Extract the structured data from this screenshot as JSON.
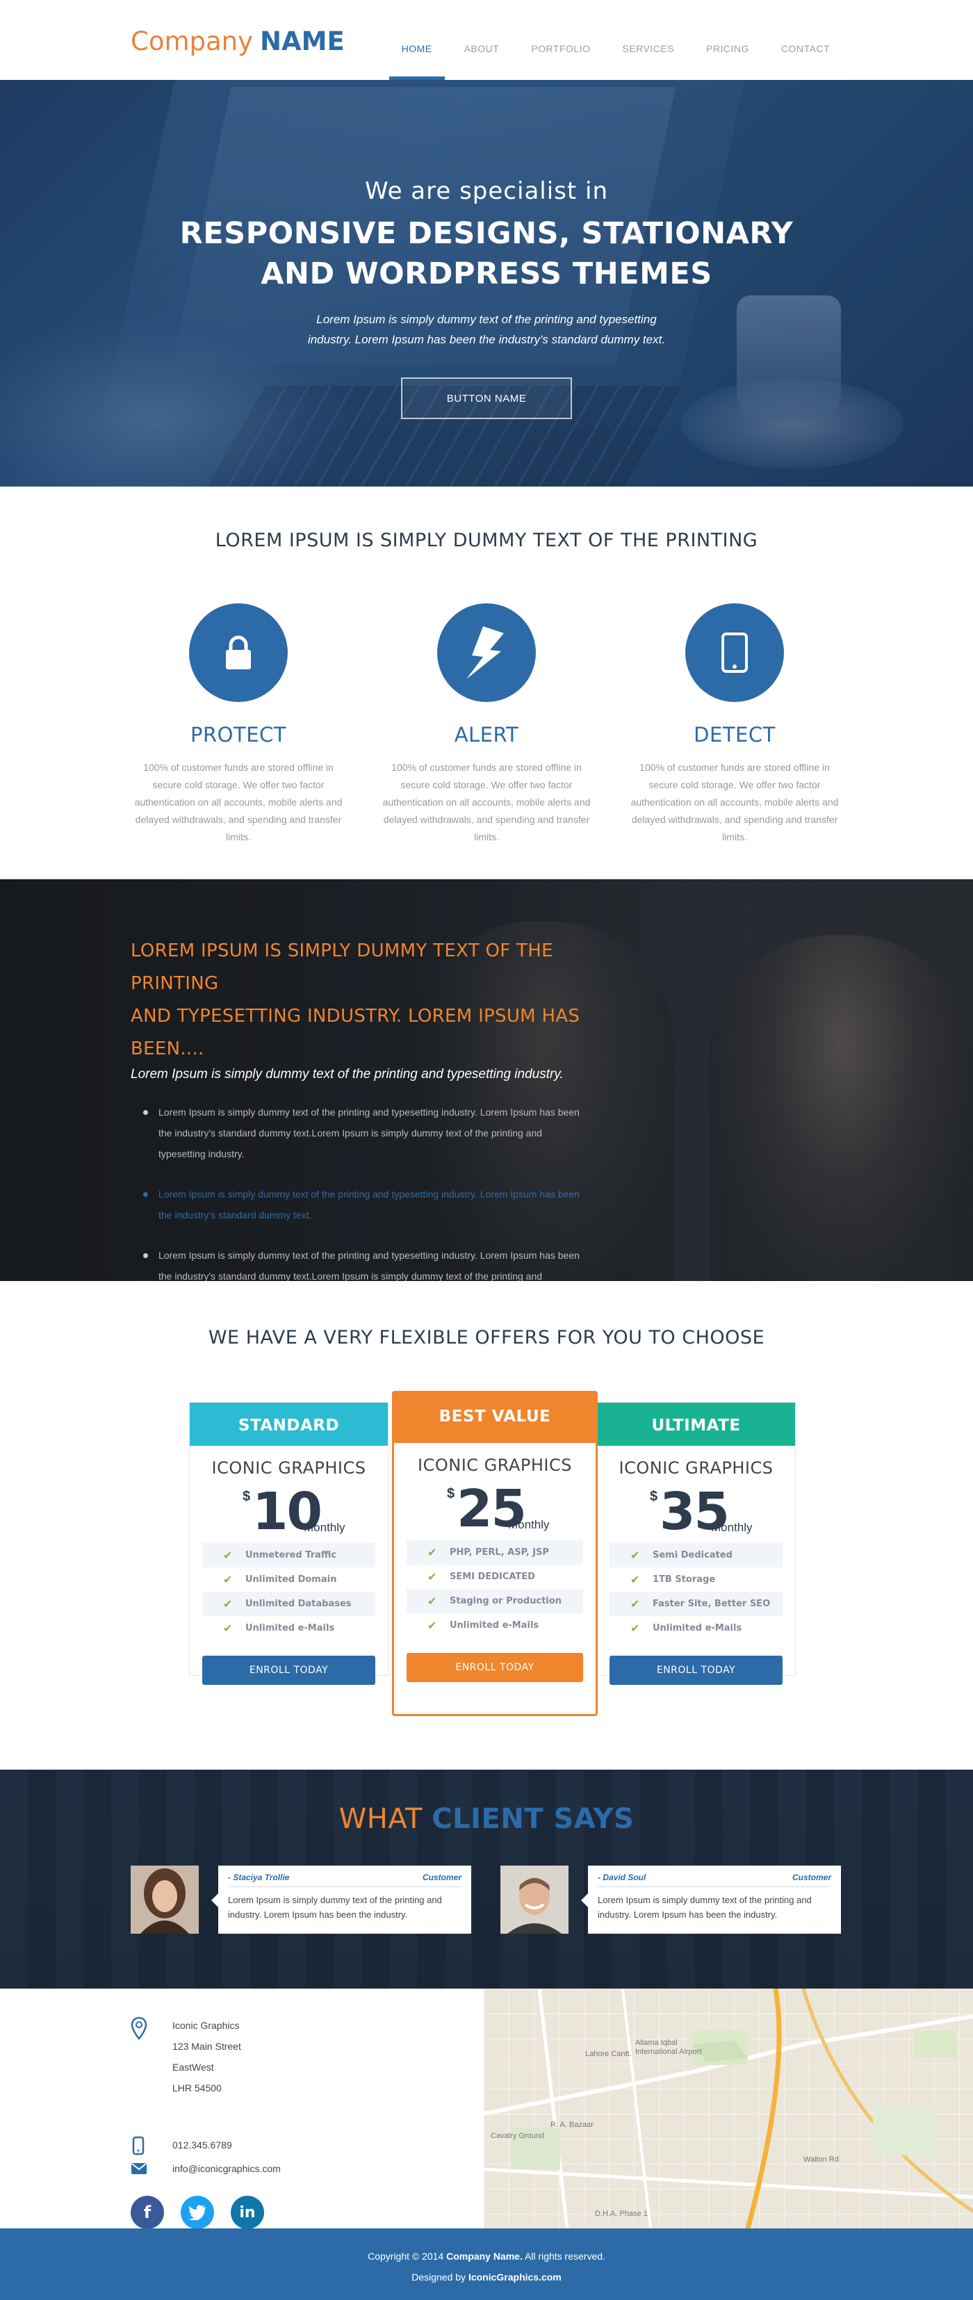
{
  "header": {
    "logo_company": "Company",
    "logo_name": "NAME",
    "nav": [
      "HOME",
      "ABOUT",
      "PORTFOLIO",
      "SERVICES",
      "PRICING",
      "CONTACT"
    ],
    "active_nav": "HOME"
  },
  "hero": {
    "pretitle": "We are specialist in",
    "title_line1": "RESPONSIVE DESIGNS, STATIONARY",
    "title_line2": "AND WORDPRESS THEMES",
    "subtitle_line1": "Lorem Ipsum is simply dummy text of the printing and typesetting",
    "subtitle_line2": "industry. Lorem Ipsum has been the industry's standard dummy text.",
    "button_label": "BUTTON NAME"
  },
  "features": {
    "heading": "LOREM IPSUM IS SIMPLY DUMMY TEXT OF THE PRINTING",
    "items": [
      {
        "title": "PROTECT",
        "icon": "lock-icon",
        "text": "100% of customer funds are stored offline in secure cold storage. We offer two factor authentication on all accounts, mobile alerts and delayed withdrawals, and spending and transfer limits."
      },
      {
        "title": "ALERT",
        "icon": "lightning-icon",
        "text": "100% of customer funds are stored offline in secure cold storage. We offer two factor authentication on all accounts, mobile alerts and delayed withdrawals, and spending and transfer limits."
      },
      {
        "title": "DETECT",
        "icon": "mobile-icon",
        "text": "100% of customer funds are stored offline in secure cold storage. We offer two factor authentication on all accounts, mobile alerts and delayed withdrawals, and spending and transfer limits."
      }
    ]
  },
  "about": {
    "heading_line1": "LOREM IPSUM IS SIMPLY DUMMY TEXT OF THE PRINTING",
    "heading_line2": "AND TYPESETTING INDUSTRY. LOREM IPSUM HAS BEEN....",
    "lead": "Lorem Ipsum is simply dummy text of the printing and typesetting industry.",
    "bullets": [
      "Lorem Ipsum is simply dummy text of the printing and typesetting industry. Lorem Ipsum has been the industry's standard dummy text.Lorem Ipsum is simply dummy text of the printing and typesetting industry.",
      "Lorem Ipsum is simply dummy text of the printing and typesetting industry. Lorem Ipsum has been the industry's standard dummy text.",
      "Lorem Ipsum is simply dummy text of the printing and typesetting industry. Lorem Ipsum has been the industry's standard dummy text.Lorem Ipsum is simply dummy text of the printing and typesetting industry."
    ]
  },
  "pricing": {
    "heading": "WE HAVE A VERY FLEXIBLE OFFERS FOR YOU TO CHOOSE",
    "plans": [
      {
        "name": "STANDARD",
        "brand": "ICONIC GRAPHICS",
        "currency": "$",
        "price": "10",
        "period": "Monthly",
        "color": "#2bbcd4",
        "button_color": "#2c6ba8",
        "features": [
          "Unmetered Traffic",
          "Unlimited Domain",
          "Unlimited Databases",
          "Unlimited e-Mails"
        ],
        "button": "ENROLL TODAY"
      },
      {
        "name": "BEST VALUE",
        "brand": "ICONIC GRAPHICS",
        "currency": "$",
        "price": "25",
        "period": "Monthly",
        "color": "#f0852d",
        "button_color": "#f0852d",
        "features": [
          "PHP, PERL, ASP, JSP",
          "SEMI DEDICATED",
          "Staging or Production",
          "Unlimited e-Mails"
        ],
        "button": "ENROLL TODAY"
      },
      {
        "name": "ULTIMATE",
        "brand": "ICONIC GRAPHICS",
        "currency": "$",
        "price": "35",
        "period": "Monthly",
        "color": "#19b394",
        "button_color": "#2c6ba8",
        "features": [
          "Semi Dedicated",
          "1TB Storage",
          "Faster Site, Better SEO",
          "Unlimited e-Mails"
        ],
        "button": "ENROLL TODAY"
      }
    ]
  },
  "testimonials": {
    "heading_part1": "WHAT",
    "heading_part2": "CLIENT SAYS",
    "items": [
      {
        "name": "- Staciya Trollie",
        "role": "Customer",
        "text": "Lorem Ipsum is simply dummy text of the printing and industry. Lorem Ipsum has been the industry."
      },
      {
        "name": "- David Soul",
        "role": "Customer",
        "text": "Lorem Ipsum is simply dummy text of the printing and industry. Lorem Ipsum has been the industry."
      }
    ]
  },
  "contact": {
    "address": [
      "Iconic Graphics",
      "123 Main Street",
      "EastWest",
      "LHR 54500"
    ],
    "phone": "012.345.6789",
    "email": "info@iconicgraphics.com",
    "social": [
      "facebook-icon",
      "twitter-icon",
      "linkedin-icon"
    ],
    "map_labels": [
      "Lahore Cantt.",
      "Allama Iqbal International Airport",
      "Cavalry Ground",
      "D.H.A. Phase 1",
      "Walton Rd",
      "R. A. Bazaar"
    ]
  },
  "footer": {
    "copyright_prefix": "Copyright © 2014",
    "company": "Company Name.",
    "rights": "All rights reserved.",
    "designed_by_label": "Designed by",
    "designer": "IconicGraphics.com"
  },
  "colors": {
    "primary": "#2c6ba8",
    "accent": "#f0852d"
  }
}
